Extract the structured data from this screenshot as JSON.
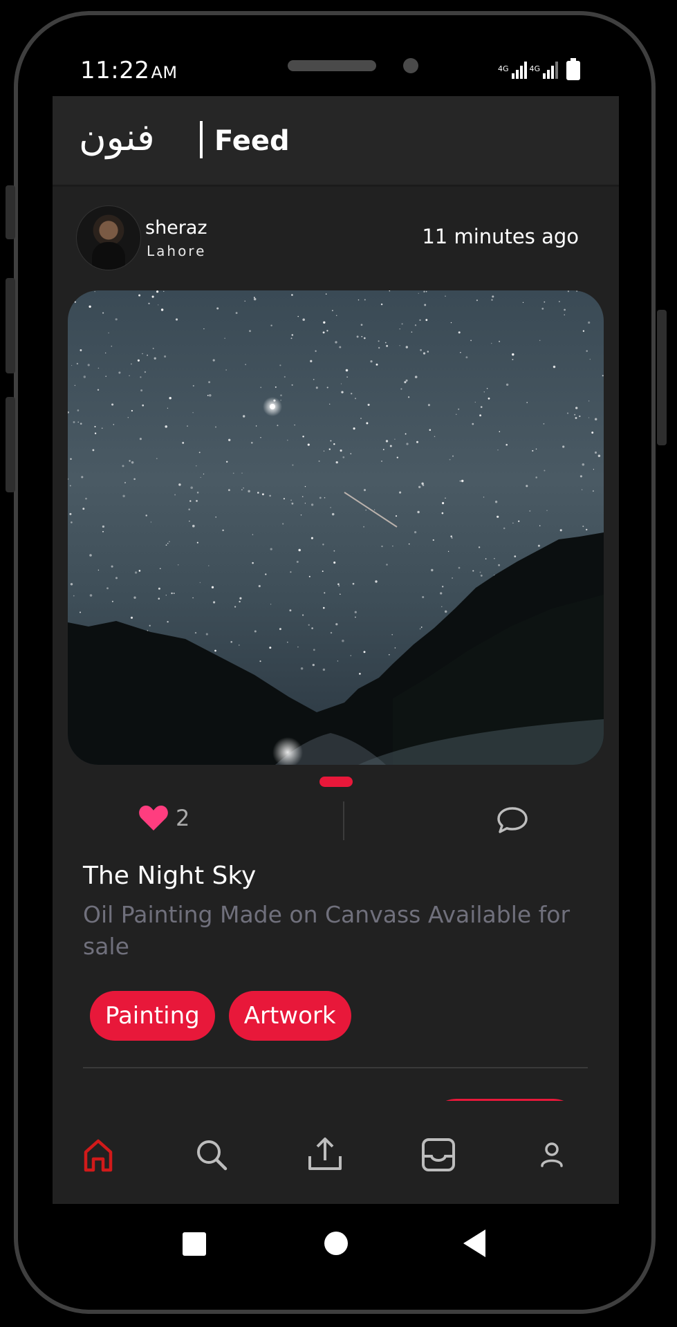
{
  "status_bar": {
    "time": "11:22",
    "ampm": "AM",
    "network_1": "4G",
    "network_2": "4G"
  },
  "header": {
    "logo_text": "فنون",
    "title": "Feed"
  },
  "post": {
    "username": "sheraz",
    "location": "Lahore",
    "timestamp": "11 minutes ago",
    "likes": "2",
    "title": "The Night Sky",
    "description": "Oil Painting Made on Canvass Available for sale",
    "tags": [
      "Painting",
      "Artwork"
    ]
  },
  "bottom_nav": {
    "items": [
      "home-icon",
      "search-icon",
      "upload-icon",
      "inbox-icon",
      "profile-icon"
    ],
    "active": "home-icon"
  },
  "colors": {
    "accent": "#e8183a",
    "background": "#212121",
    "heart": "#ff3d7f"
  }
}
